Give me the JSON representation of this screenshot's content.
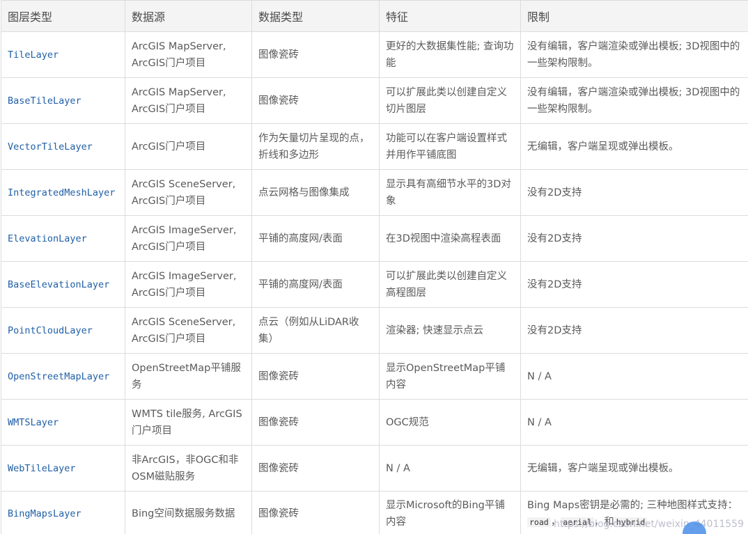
{
  "headers": [
    "图层类型",
    "数据源",
    "数据类型",
    "特征",
    "限制"
  ],
  "rows": [
    {
      "name": "TileLayer",
      "source": "ArcGIS MapServer, ArcGIS门户项目",
      "dtype": "图像瓷砖",
      "feature": "更好的大数据集性能; 查询功能",
      "limit": "没有编辑，客户端渲染或弹出模板; 3D视图中的一些架构限制。"
    },
    {
      "name": "BaseTileLayer",
      "source": "ArcGIS MapServer, ArcGIS门户项目",
      "dtype": "图像瓷砖",
      "feature": "可以扩展此类以创建自定义切片图层",
      "limit": "没有编辑，客户端渲染或弹出模板; 3D视图中的一些架构限制。"
    },
    {
      "name": "VectorTileLayer",
      "source": "ArcGIS门户项目",
      "dtype": "作为矢量切片呈现的点，折线和多边形",
      "feature": "功能可以在客户端设置样式并用作平铺底图",
      "limit": "无编辑，客户端呈现或弹出模板。"
    },
    {
      "name": "IntegratedMeshLayer",
      "source": "ArcGIS SceneServer, ArcGIS门户项目",
      "dtype": "点云网格与图像集成",
      "feature": "显示具有高细节水平的3D对象",
      "limit": "没有2D支持"
    },
    {
      "name": "ElevationLayer",
      "source": "ArcGIS ImageServer, ArcGIS门户项目",
      "dtype": "平铺的高度网/表面",
      "feature": "在3D视图中渲染高程表面",
      "limit": "没有2D支持"
    },
    {
      "name": "BaseElevationLayer",
      "source": "ArcGIS ImageServer, ArcGIS门户项目",
      "dtype": "平铺的高度网/表面",
      "feature": "可以扩展此类以创建自定义高程图层",
      "limit": "没有2D支持"
    },
    {
      "name": "PointCloudLayer",
      "source": "ArcGIS SceneServer, ArcGIS门户项目",
      "dtype": "点云（例如从LiDAR收集）",
      "feature": "渲染器; 快速显示点云",
      "limit": "没有2D支持"
    },
    {
      "name": "OpenStreetMapLayer",
      "source": "OpenStreetMap平铺服务",
      "dtype": "图像瓷砖",
      "feature": "显示OpenStreetMap平铺内容",
      "limit": "N / A"
    },
    {
      "name": "WMTSLayer",
      "source": "WMTS tile服务, ArcGIS门户项目",
      "dtype": "图像瓷砖",
      "feature": "OGC规范",
      "limit": "N / A"
    },
    {
      "name": "WebTileLayer",
      "source": "非ArcGIS，非OGC和非OSM磁贴服务",
      "dtype": "图像瓷砖",
      "feature": "N / A",
      "limit": "无编辑，客户端呈现或弹出模板。"
    },
    {
      "name": "BingMapsLayer",
      "source": "Bing空间数据服务数据",
      "dtype": "图像瓷砖",
      "feature": "显示Microsoft的Bing平铺内容",
      "limit": "Bing Maps密钥是必需的; 三种地图样式支持："
    }
  ],
  "bing_styles": {
    "road": "road",
    "aerial": "aerial",
    "sep1": "，",
    "sep2": "，和",
    "hybrid": "hybrid"
  },
  "watermark": "https://blog.csdn.net/weixin_44011559"
}
